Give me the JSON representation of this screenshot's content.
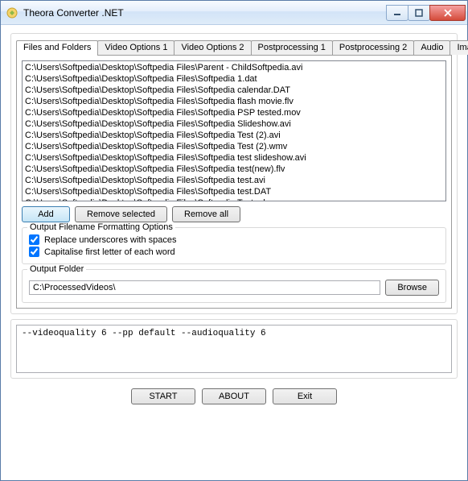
{
  "window": {
    "title": "Theora Converter .NET"
  },
  "tabs": {
    "items": [
      "Files and Folders",
      "Video Options 1",
      "Video Options 2",
      "Postprocessing 1",
      "Postprocessing 2",
      "Audio",
      "Ima"
    ],
    "active_index": 0
  },
  "files": [
    "C:\\Users\\Softpedia\\Desktop\\Softpedia Files\\Parent - ChildSoftpedia.avi",
    "C:\\Users\\Softpedia\\Desktop\\Softpedia Files\\Softpedia 1.dat",
    "C:\\Users\\Softpedia\\Desktop\\Softpedia Files\\Softpedia calendar.DAT",
    "C:\\Users\\Softpedia\\Desktop\\Softpedia Files\\Softpedia flash movie.flv",
    "C:\\Users\\Softpedia\\Desktop\\Softpedia Files\\Softpedia PSP tested.mov",
    "C:\\Users\\Softpedia\\Desktop\\Softpedia Files\\Softpedia Slideshow.avi",
    "C:\\Users\\Softpedia\\Desktop\\Softpedia Files\\Softpedia Test (2).avi",
    "C:\\Users\\Softpedia\\Desktop\\Softpedia Files\\Softpedia Test (2).wmv",
    "C:\\Users\\Softpedia\\Desktop\\Softpedia Files\\Softpedia test slideshow.avi",
    "C:\\Users\\Softpedia\\Desktop\\Softpedia Files\\Softpedia test(new).flv",
    "C:\\Users\\Softpedia\\Desktop\\Softpedia Files\\Softpedia test.avi",
    "C:\\Users\\Softpedia\\Desktop\\Softpedia Files\\Softpedia test.DAT",
    "C:\\Users\\Softpedia\\Desktop\\Softpedia Files\\Softpedia Test.mkv"
  ],
  "buttons": {
    "add": "Add",
    "remove_selected": "Remove selected",
    "remove_all": "Remove all",
    "browse": "Browse",
    "start": "START",
    "about": "ABOUT",
    "exit": "Exit"
  },
  "format_options": {
    "legend": "Output Filename Formatting Options",
    "replace_underscores": {
      "label": "Replace underscores with spaces",
      "checked": true
    },
    "capitalise": {
      "label": "Capitalise first letter of each word",
      "checked": true
    }
  },
  "output_folder": {
    "legend": "Output Folder",
    "path": "C:\\ProcessedVideos\\"
  },
  "command_line": "--videoquality 6 --pp default --audioquality 6"
}
